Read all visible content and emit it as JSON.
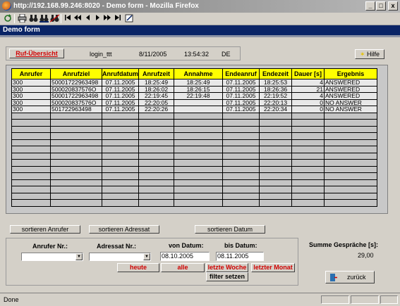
{
  "window": {
    "title": "http://192.168.99.246:8020 - Demo form - Mozilla Firefox",
    "min_label": "_",
    "max_label": "□",
    "close_label": "x"
  },
  "toolbar": {
    "icons": [
      "reload-icon",
      "print-icon",
      "search-binoculars-icon",
      "search-all-icon",
      "search-clear-icon",
      "first-icon",
      "previous-page-icon",
      "previous-icon",
      "next-icon",
      "next-page-icon",
      "last-icon",
      "edit-icon"
    ]
  },
  "app": {
    "header_title": "Demo form"
  },
  "info": {
    "ruf_button": "Ruf-Übersicht",
    "user": "login_ttt",
    "date": "8/11/2005",
    "time": "13:54:32",
    "lang": "DE",
    "help_button": "Hilfe"
  },
  "table": {
    "columns": [
      "Anrufer",
      "Anrufziel",
      "Anrufdatum",
      "Anrufzeit",
      "Annahme",
      "Endeanruf",
      "Endezeit",
      "Dauer [s]",
      "Ergebnis"
    ],
    "rows": [
      [
        "300",
        "50001722963498",
        "07.11.2005",
        "18:25:49",
        "18:25:49",
        "07.11.2005",
        "18:25:53",
        "4",
        "ANSWERED"
      ],
      [
        "300",
        "500020837576O",
        "07.11.2005",
        "18:26:02",
        "18:26:15",
        "07.11.2005",
        "18:26:36",
        "21",
        "ANSWERED"
      ],
      [
        "300",
        "50001722963498",
        "07.11.2005",
        "22:19:45",
        "22:19:48",
        "07.11.2005",
        "22:19:52",
        "4",
        "ANSWERED"
      ],
      [
        "300",
        "500020837576O",
        "07.11.2005",
        "22:20:05",
        "",
        "07.11.2005",
        "22:20:13",
        "0",
        "NO ANSWER"
      ],
      [
        "300",
        "501722963498",
        "07.11.2005",
        "22:20:26",
        "",
        "07.11.2005",
        "22:20:34",
        "0",
        "NO ANSWER"
      ]
    ],
    "empty_rows": 14
  },
  "sort": {
    "by_caller": "sortieren Anrufer",
    "by_target": "sortieren Adressat",
    "by_date": "sortieren Datum"
  },
  "filter": {
    "caller_label": "Anrufer Nr.:",
    "target_label": "Adressat Nr.:",
    "from_label": "von Datum:",
    "to_label": "bis Datum:",
    "from_value": "08.10.2005",
    "to_value": "08.11.2005",
    "today": "heute",
    "all": "alle",
    "last_week": "letzte Woche",
    "last_month": "letzter Monat",
    "apply": "filter setzen"
  },
  "summary": {
    "label": "Summe Gespräche [s]:",
    "value": "29,00",
    "back_button": "zurück"
  },
  "status": {
    "text": "Done"
  },
  "colors": {
    "header_bg": "#0a2466",
    "column_header": "#ffff00",
    "accent_red": "#d00000"
  }
}
